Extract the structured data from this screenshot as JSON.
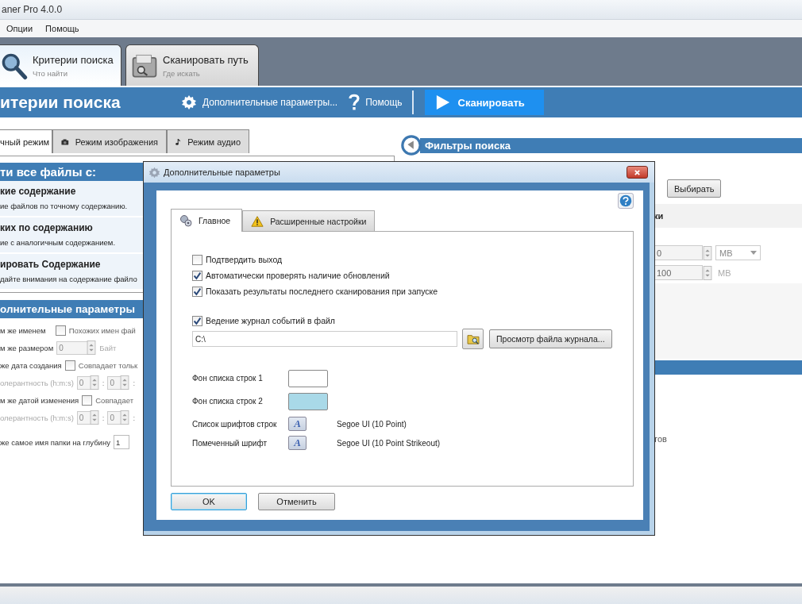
{
  "window": {
    "title": "aner Pro 4.0.0"
  },
  "menu": [
    "Опции",
    "Помощь"
  ],
  "main_tabs": [
    {
      "kind": "search",
      "label": "Критерии поиска",
      "subtitle": "Что найти",
      "selected": true
    },
    {
      "kind": "scanner",
      "label": "Сканировать путь",
      "subtitle": "Где искать",
      "selected": false
    }
  ],
  "toolbar": {
    "title": "итерии поиска",
    "actions": [
      {
        "kind": "settings",
        "label": "Дополнительные параметры..."
      },
      {
        "kind": "help",
        "label": "Помощь"
      }
    ],
    "scan_button": "Сканировать"
  },
  "mode_tabs": [
    {
      "kind": "plain",
      "label": "чный режим",
      "selected": true
    },
    {
      "kind": "camera",
      "label": "Режим изображения",
      "selected": false
    },
    {
      "kind": "music",
      "label": "Режим аудио",
      "selected": false
    }
  ],
  "search_panel": {
    "title": "ти все файлы с:",
    "options": [
      {
        "title": "кие содержание",
        "description": "ие файлов по точному содержанию."
      },
      {
        "title": "ких по содержанию",
        "description": "ие с аналогичным содержанием."
      },
      {
        "title": "ировать Содержание",
        "description": "дайте внимания на содержание файло"
      }
    ]
  },
  "extra_panel": {
    "title": "олнительные параметры",
    "rows": [
      {
        "label": "м же именем",
        "disabled": false,
        "parts": [
          {
            "kind": "checkbox",
            "checked": false,
            "label": "Похожих имен фай"
          }
        ]
      },
      {
        "label": "м же размером",
        "disabled": false,
        "parts": [
          {
            "kind": "spin",
            "value": "0"
          },
          {
            "kind": "unit",
            "text": "Байт"
          }
        ]
      },
      {
        "label": "же дата создания",
        "disabled": false,
        "parts": [
          {
            "kind": "checkbox",
            "checked": false,
            "label": "Совпадает тольк"
          }
        ]
      },
      {
        "label": "олерантность (h:m:s)",
        "disabled": true,
        "parts": [
          {
            "kind": "spin",
            "value": "0"
          },
          {
            "kind": "sep",
            "text": ":"
          },
          {
            "kind": "spin",
            "value": "0"
          },
          {
            "kind": "sep",
            "text": ":"
          }
        ]
      },
      {
        "label": "м же датой изменения",
        "disabled": false,
        "parts": [
          {
            "kind": "checkbox",
            "checked": false,
            "label": "Совпадает"
          }
        ]
      },
      {
        "label": "олерантность (h:m:s)",
        "disabled": true,
        "parts": [
          {
            "kind": "spin",
            "value": "0"
          },
          {
            "kind": "sep",
            "text": ":"
          },
          {
            "kind": "spin",
            "value": "0"
          },
          {
            "kind": "sep",
            "text": ":"
          }
        ]
      },
      {
        "label": "же самое имя папки на глубину",
        "disabled": false,
        "parts": [
          {
            "kind": "input",
            "value": "1"
          }
        ]
      }
    ]
  },
  "filters": {
    "title": "Фильтры поиска",
    "select_button": "Выбирать",
    "section_fragment": "ки",
    "size_rows": [
      {
        "kind": "dropdown",
        "value": "0",
        "unit": "MB"
      },
      {
        "kind": "text",
        "value": "100",
        "unit": "MB"
      }
    ],
    "text_fragment": "тов"
  },
  "dialog": {
    "title": "Дополнительные параметры",
    "tabs": [
      {
        "kind": "gear",
        "label": "Главное",
        "selected": true
      },
      {
        "kind": "warning",
        "label": "Расширенные настройки",
        "selected": false
      }
    ],
    "checkboxes": [
      {
        "label": "Подтвердить выход",
        "checked": false
      },
      {
        "label": "Автоматически проверять наличие обновлений",
        "checked": true
      },
      {
        "label": "Показать результаты последнего сканирования при запуске",
        "checked": true
      }
    ],
    "log": {
      "label": "Ведение журнал событий в файл",
      "checked": true,
      "path": "C:\\",
      "view_button": "Просмотр файла журнала..."
    },
    "colors": [
      {
        "label": "Фон списка строк 1",
        "color": "#ffffff"
      },
      {
        "label": "Фон списка строк 2",
        "color": "#a9d9e8"
      }
    ],
    "fonts": [
      {
        "label": "Список шрифтов строк",
        "glyph": "A",
        "value": "Segoe UI (10 Point)"
      },
      {
        "label": "Помеченный шрифт",
        "glyph": "A",
        "value": "Segoe UI (10 Point Strikeout)"
      }
    ],
    "ok_button": "OK",
    "cancel_button": "Отменить"
  }
}
